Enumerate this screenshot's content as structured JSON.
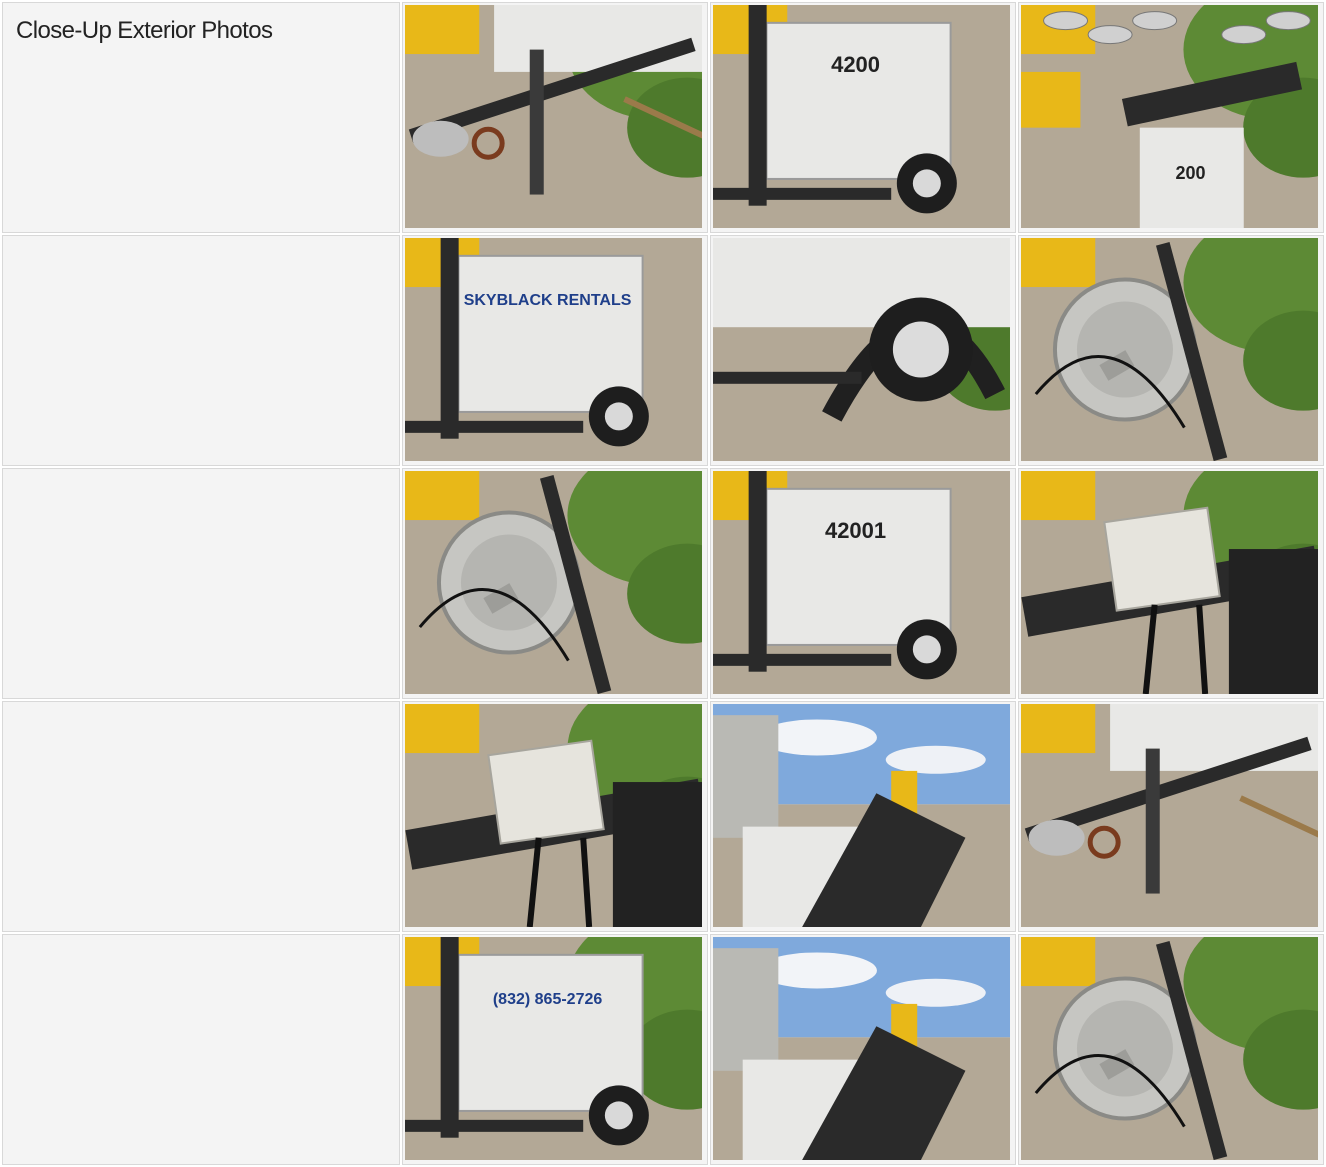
{
  "section": {
    "title": "Close-Up Exterior Photos"
  },
  "rows": [
    {
      "label": "Close-Up Exterior Photos",
      "photos": [
        {
          "name": "hitch-jack-photo",
          "scene": "ground",
          "text": ""
        },
        {
          "name": "rear-tower-photo",
          "scene": "unit",
          "text": "4200"
        },
        {
          "name": "mast-lamps-photo",
          "scene": "mast",
          "text": "200"
        }
      ]
    },
    {
      "label": "",
      "photos": [
        {
          "name": "unit-side-photo",
          "scene": "unit",
          "text": "SKYBLACK RENTALS"
        },
        {
          "name": "wheel-fender-photo",
          "scene": "wheel",
          "text": ""
        },
        {
          "name": "lamp-heads-photo",
          "scene": "lamp",
          "text": ""
        }
      ]
    },
    {
      "label": "",
      "photos": [
        {
          "name": "single-lamp-photo",
          "scene": "lamp",
          "text": ""
        },
        {
          "name": "unit-rear-photo",
          "scene": "unit",
          "text": "42001"
        },
        {
          "name": "junction-box-photo",
          "scene": "box",
          "text": ""
        }
      ]
    },
    {
      "label": "",
      "photos": [
        {
          "name": "box-cables-photo",
          "scene": "box",
          "text": ""
        },
        {
          "name": "yard-view-photo",
          "scene": "sky",
          "text": ""
        },
        {
          "name": "trailer-tongue-photo",
          "scene": "ground",
          "text": ""
        }
      ]
    },
    {
      "label": "",
      "photos": [
        {
          "name": "unit-phone-photo",
          "scene": "unit",
          "text": "(832) 865-2726"
        },
        {
          "name": "lamp-cord-sky-photo",
          "scene": "sky",
          "text": ""
        },
        {
          "name": "hand-lamp-photo",
          "scene": "lamp",
          "text": ""
        }
      ]
    }
  ],
  "colors": {
    "cell_bg": "#f4f4f4",
    "border": "#d8d8d8",
    "generator_white": "#e8e8e6",
    "frame_black": "#2a2a2a",
    "ground": "#b3a896",
    "foliage": "#5d8a35",
    "equipment_yellow": "#e8b818",
    "sky": "#7fa9dc"
  }
}
